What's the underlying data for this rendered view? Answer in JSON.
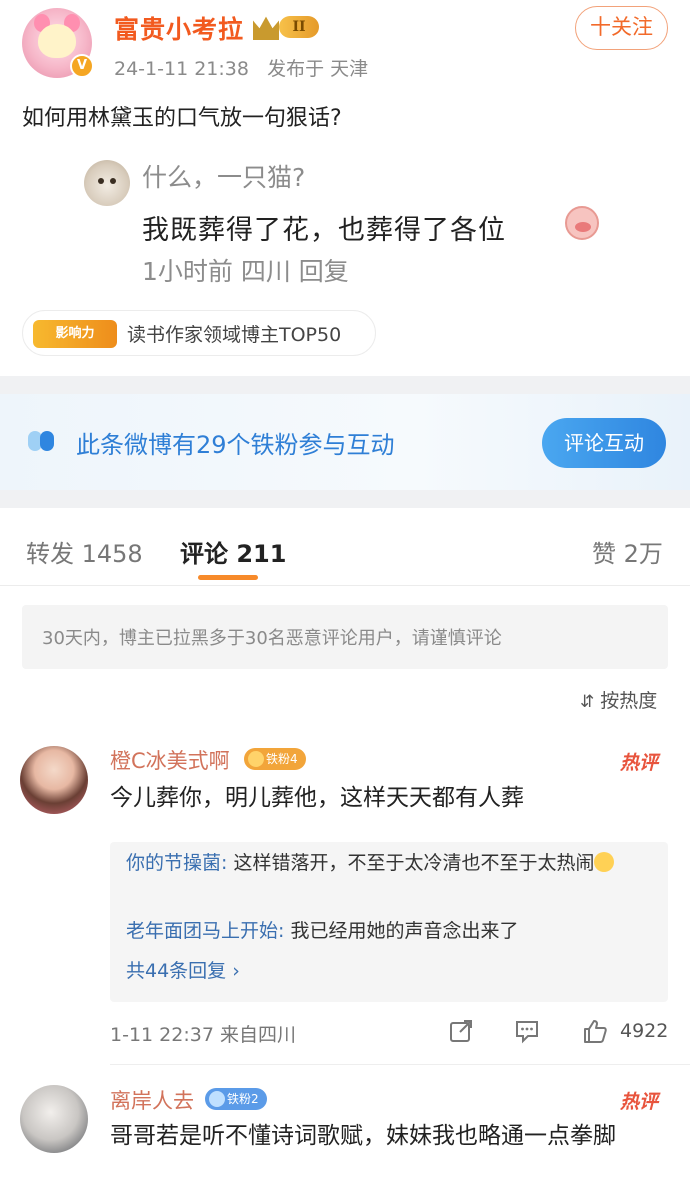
{
  "post": {
    "author": "富贵小考拉",
    "author_level": "II",
    "avatar_badge": "V",
    "timestamp": "24-1-11 21:38",
    "location_prefix": "发布于",
    "location": "天津",
    "follow_label": "十关注",
    "text": "如何用林黛玉的口气放一句狠话?"
  },
  "quoted": {
    "name": "什么，一只猫?",
    "text": "我既葬得了花，也葬得了各位",
    "meta": "1小时前  四川  回复"
  },
  "influence": {
    "tag": "影响力",
    "text": "读书作家领域博主TOP50"
  },
  "iron_fans": {
    "text": "此条微博有29个铁粉参与互动",
    "button": "评论互动"
  },
  "tabs": {
    "repost": "转发 1458",
    "comments": "评论 211",
    "likes": "赞 2万"
  },
  "notice": "30天内，博主已拉黑多于30名恶意评论用户，请谨慎评论",
  "sort_label": "按热度",
  "comments": [
    {
      "name": "橙C冰美式啊",
      "badge": "铁粉4",
      "hot": "热评",
      "text": "今儿葬你，明儿葬他，这样天天都有人葬",
      "replies": [
        {
          "name": "你的节操菌:",
          "text": " 这样错落开，不至于太冷清也不至于太热闹"
        },
        {
          "name": "老年面团马上开始:",
          "text": " 我已经用她的声音念出来了"
        }
      ],
      "more_replies": "共44条回复 ›",
      "meta": "1-11 22:37  来自四川",
      "likes": "4922"
    },
    {
      "name": "离岸人去",
      "badge": "铁粉2",
      "hot": "热评",
      "text": "哥哥若是听不懂诗词歌赋，妹妹我也略通一点拳脚"
    }
  ],
  "colors": {
    "accent_orange": "#f26a2a",
    "link_blue": "#3a6fb0",
    "hot_red": "#e8543d"
  }
}
